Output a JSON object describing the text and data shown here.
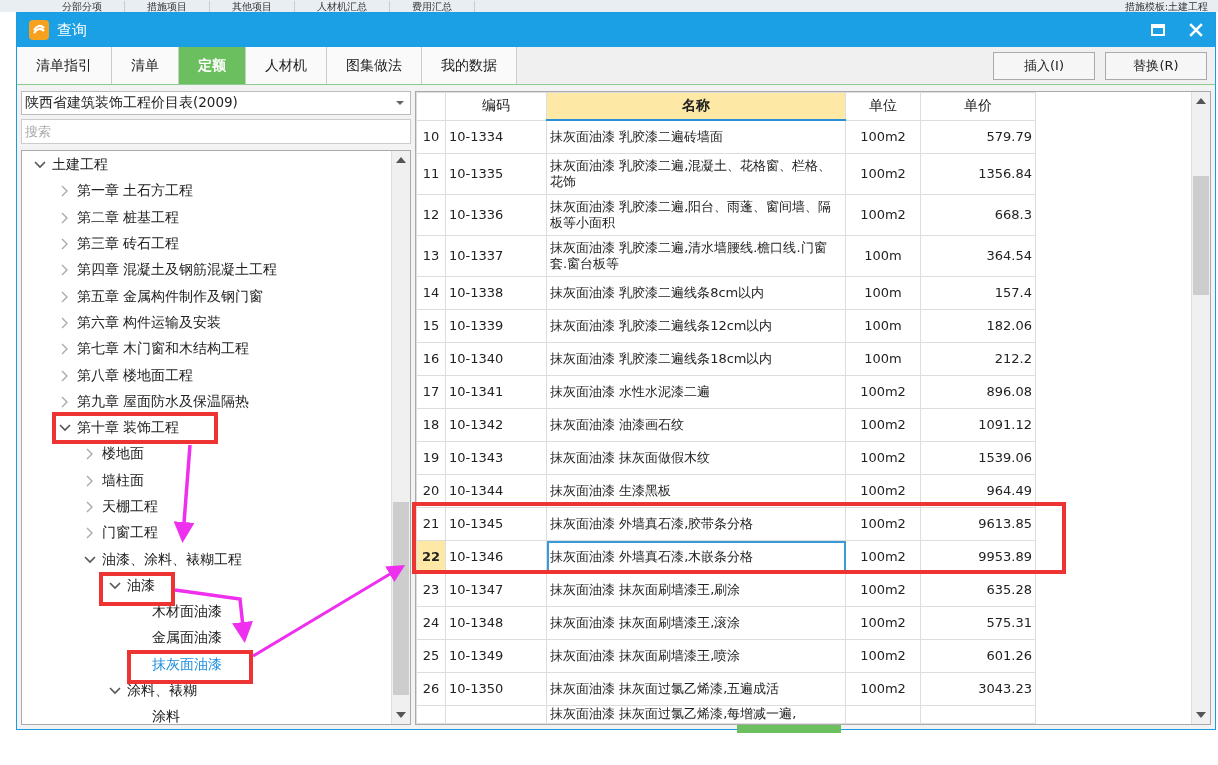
{
  "background_tabs": [
    "分部分项",
    "措施项目",
    "其他项目",
    "人材机汇总",
    "费用汇总"
  ],
  "background_template": "措施模板:土建工程",
  "window": {
    "title": "查询"
  },
  "tabs": [
    {
      "label": "清单指引",
      "selected": false
    },
    {
      "label": "清单",
      "selected": false
    },
    {
      "label": "定额",
      "selected": true
    },
    {
      "label": "人材机",
      "selected": false
    },
    {
      "label": "图集做法",
      "selected": false
    },
    {
      "label": "我的数据",
      "selected": false
    }
  ],
  "buttons": [
    "插入(I)",
    "替换(R)"
  ],
  "library": {
    "value": "陕西省建筑装饰工程价目表(2009)"
  },
  "search": {
    "placeholder": "搜索"
  },
  "tree": [
    {
      "label": "土建工程",
      "expanded": true,
      "selected": false,
      "children": [
        {
          "label": "第一章  土石方工程",
          "expanded": false,
          "selected": false
        },
        {
          "label": "第二章  桩基工程",
          "expanded": false,
          "selected": false
        },
        {
          "label": "第三章  砖石工程",
          "expanded": false,
          "selected": false
        },
        {
          "label": "第四章  混凝土及钢筋混凝土工程",
          "expanded": false,
          "selected": false
        },
        {
          "label": "第五章  金属构件制作及钢门窗",
          "expanded": false,
          "selected": false
        },
        {
          "label": "第六章  构件运输及安装",
          "expanded": false,
          "selected": false
        },
        {
          "label": "第七章  木门窗和木结构工程",
          "expanded": false,
          "selected": false
        },
        {
          "label": "第八章  楼地面工程",
          "expanded": false,
          "selected": false
        },
        {
          "label": "第九章  屋面防水及保温隔热",
          "expanded": false,
          "selected": false
        },
        {
          "label": "第十章  装饰工程",
          "expanded": true,
          "selected": false,
          "children": [
            {
              "label": "楼地面",
              "expanded": false,
              "selected": false
            },
            {
              "label": "墙柱面",
              "expanded": false,
              "selected": false
            },
            {
              "label": "天棚工程",
              "expanded": false,
              "selected": false
            },
            {
              "label": "门窗工程",
              "expanded": false,
              "selected": false
            },
            {
              "label": "油漆、涂料、裱糊工程",
              "expanded": true,
              "selected": false,
              "children": [
                {
                  "label": "油漆",
                  "expanded": true,
                  "selected": false,
                  "children": [
                    {
                      "label": "木材面油漆",
                      "selected": false
                    },
                    {
                      "label": "金属面油漆",
                      "selected": false
                    },
                    {
                      "label": "抹灰面油漆",
                      "selected": true
                    }
                  ]
                },
                {
                  "label": "涂料、裱糊",
                  "expanded": true,
                  "selected": false,
                  "children": [
                    {
                      "label": "涂料",
                      "selected": false
                    }
                  ]
                }
              ]
            }
          ]
        }
      ]
    }
  ],
  "table": {
    "columns": [
      {
        "label": "编码",
        "highlighted": false
      },
      {
        "label": "名称",
        "highlighted": true
      },
      {
        "label": "单位",
        "highlighted": false
      },
      {
        "label": "单价",
        "highlighted": false
      }
    ],
    "rows": [
      {
        "number": "10",
        "code": "10-1334",
        "name": "抹灰面油漆 乳胶漆二遍砖墙面",
        "unit": "100m2",
        "price": "579.79",
        "selected": false
      },
      {
        "number": "11",
        "code": "10-1335",
        "name": "抹灰面油漆 乳胶漆二遍,混凝土、花格窗、栏格、花饰",
        "unit": "100m2",
        "price": "1356.84",
        "selected": false
      },
      {
        "number": "12",
        "code": "10-1336",
        "name": "抹灰面油漆 乳胶漆二遍,阳台、雨蓬、窗间墙、隔板等小面积",
        "unit": "100m2",
        "price": "668.3",
        "selected": false
      },
      {
        "number": "13",
        "code": "10-1337",
        "name": "抹灰面油漆 乳胶漆二遍,清水墙腰线.檐口线.门窗套.窗台板等",
        "unit": "100m",
        "price": "364.54",
        "selected": false
      },
      {
        "number": "14",
        "code": "10-1338",
        "name": "抹灰面油漆 乳胶漆二遍线条8cm以内",
        "unit": "100m",
        "price": "157.4",
        "selected": false
      },
      {
        "number": "15",
        "code": "10-1339",
        "name": "抹灰面油漆 乳胶漆二遍线条12cm以内",
        "unit": "100m",
        "price": "182.06",
        "selected": false
      },
      {
        "number": "16",
        "code": "10-1340",
        "name": "抹灰面油漆 乳胶漆二遍线条18cm以内",
        "unit": "100m",
        "price": "212.2",
        "selected": false
      },
      {
        "number": "17",
        "code": "10-1341",
        "name": "抹灰面油漆 水性水泥漆二遍",
        "unit": "100m2",
        "price": "896.08",
        "selected": false
      },
      {
        "number": "18",
        "code": "10-1342",
        "name": "抹灰面油漆 油漆画石纹",
        "unit": "100m2",
        "price": "1091.12",
        "selected": false
      },
      {
        "number": "19",
        "code": "10-1343",
        "name": "抹灰面油漆 抹灰面做假木纹",
        "unit": "100m2",
        "price": "1539.06",
        "selected": false
      },
      {
        "number": "20",
        "code": "10-1344",
        "name": "抹灰面油漆 生漆黑板",
        "unit": "100m2",
        "price": "964.49",
        "selected": false
      },
      {
        "number": "21",
        "code": "10-1345",
        "name": "抹灰面油漆 外墙真石漆,胶带条分格",
        "unit": "100m2",
        "price": "9613.85",
        "selected": false
      },
      {
        "number": "22",
        "code": "10-1346",
        "name": "抹灰面油漆 外墙真石漆,木嵌条分格",
        "unit": "100m2",
        "price": "9953.89",
        "selected": true
      },
      {
        "number": "23",
        "code": "10-1347",
        "name": "抹灰面油漆 抹灰面刷墙漆王,刷涂",
        "unit": "100m2",
        "price": "635.28",
        "selected": false
      },
      {
        "number": "24",
        "code": "10-1348",
        "name": "抹灰面油漆 抹灰面刷墙漆王,滚涂",
        "unit": "100m2",
        "price": "575.31",
        "selected": false
      },
      {
        "number": "25",
        "code": "10-1349",
        "name": "抹灰面油漆 抹灰面刷墙漆王,喷涂",
        "unit": "100m2",
        "price": "601.26",
        "selected": false
      },
      {
        "number": "26",
        "code": "10-1350",
        "name": "抹灰面油漆 抹灰面过氯乙烯漆,五遍成活",
        "unit": "100m2",
        "price": "3043.23",
        "selected": false
      },
      {
        "name": "抹灰面油漆 抹灰面过氯乙烯漆,每增减一遍,",
        "selected": false
      }
    ]
  }
}
